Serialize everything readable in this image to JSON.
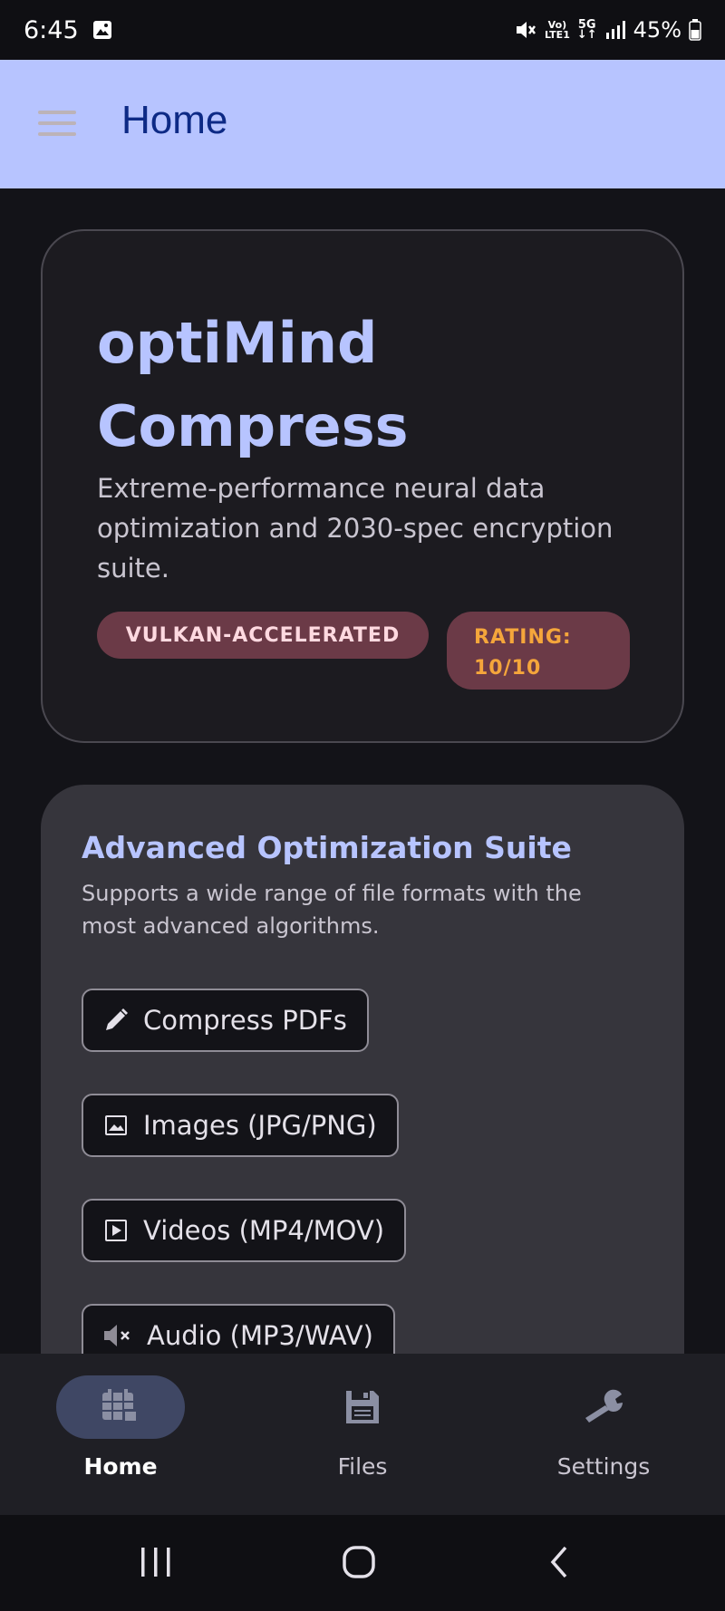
{
  "status_bar": {
    "time": "6:45",
    "volte": "Vo)",
    "lte": "LTE1",
    "network": "5G",
    "battery": "45%"
  },
  "top_bar": {
    "title": "Home"
  },
  "hero": {
    "title": "optiMind Compress",
    "subtitle": "Extreme-performance neural data optimization and 2030-spec encryption suite.",
    "badge_accel": "VULKAN-ACCELERATED",
    "badge_rating": "RATING: 10/10"
  },
  "suite": {
    "title": "Advanced Optimization Suite",
    "description": "Supports a wide range of file formats with the most advanced algorithms.",
    "buttons": [
      {
        "label": "Compress PDFs",
        "icon": "pencil-icon"
      },
      {
        "label": "Images (JPG/PNG)",
        "icon": "image-icon"
      },
      {
        "label": "Videos (MP4/MOV)",
        "icon": "video-icon"
      },
      {
        "label": "Audio (MP3/WAV)",
        "icon": "mute-icon"
      }
    ]
  },
  "bottom_nav": {
    "items": [
      {
        "label": "Home",
        "icon": "home-grid-icon",
        "active": true
      },
      {
        "label": "Files",
        "icon": "save-icon",
        "active": false
      },
      {
        "label": "Settings",
        "icon": "wrench-icon",
        "active": false
      }
    ]
  },
  "colors": {
    "primary": "#b7c4ff",
    "background": "#131318",
    "badge_bg": "#6b3a47",
    "rating_text": "#f5a63b"
  }
}
